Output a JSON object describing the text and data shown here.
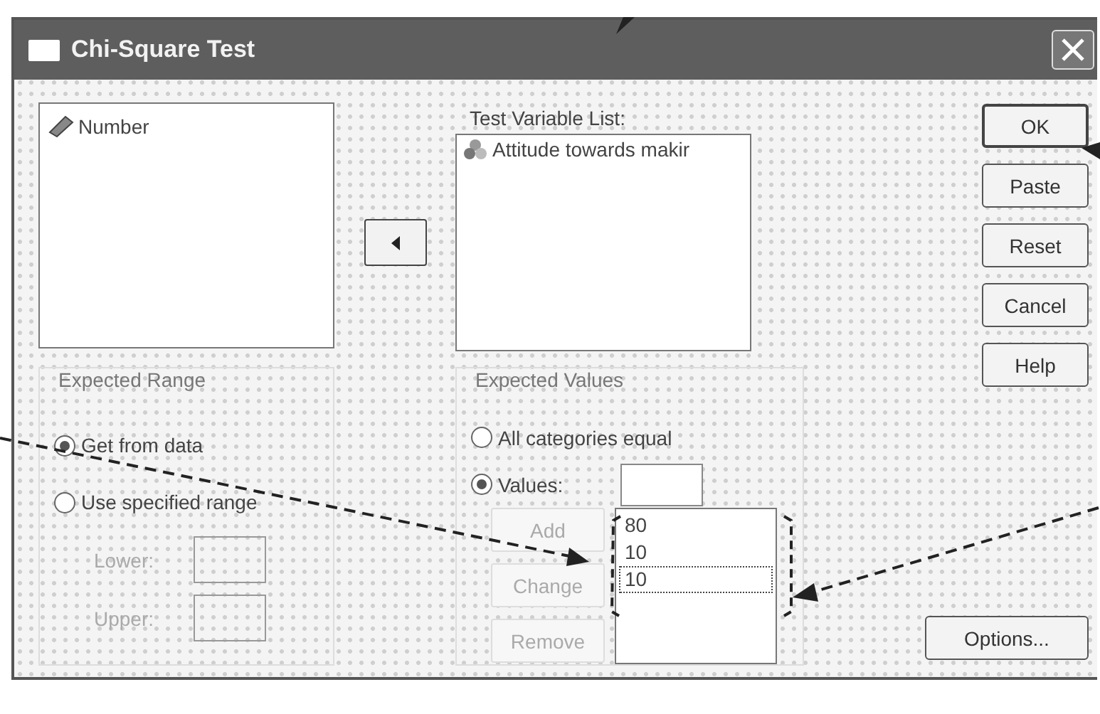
{
  "window": {
    "title": "Chi-Square Test"
  },
  "source_list": {
    "items": [
      {
        "label": "Number",
        "kind": "scale"
      }
    ]
  },
  "test_variable_list": {
    "label": "Test Variable List:",
    "items": [
      {
        "label": "Attitude towards makir",
        "kind": "nominal"
      }
    ]
  },
  "buttons": [
    {
      "label": "OK",
      "default": true
    },
    {
      "label": "Paste",
      "default": false
    },
    {
      "label": "Reset",
      "default": false
    },
    {
      "label": "Cancel",
      "default": false
    },
    {
      "label": "Help",
      "default": false
    }
  ],
  "expected_range": {
    "title": "Expected Range",
    "options": [
      {
        "label": "Get from data",
        "selected": true
      },
      {
        "label": "Use specified range",
        "selected": false
      }
    ],
    "fields": [
      {
        "label": "Lower:",
        "disabled": true
      },
      {
        "label": "Upper:",
        "disabled": true
      }
    ]
  },
  "expected_values": {
    "title": "Expected Values",
    "options": [
      {
        "label": "All categories equal",
        "selected": false
      },
      {
        "label": "Values:",
        "selected": true
      }
    ],
    "actions": [
      {
        "label": "Add",
        "disabled": true
      },
      {
        "label": "Change",
        "disabled": true
      },
      {
        "label": "Remove",
        "disabled": true
      }
    ],
    "values": [
      {
        "label": "80",
        "focused": false
      },
      {
        "label": "10",
        "focused": false
      },
      {
        "label": "10",
        "focused": true
      }
    ]
  },
  "options_button": {
    "label": "Options..."
  }
}
